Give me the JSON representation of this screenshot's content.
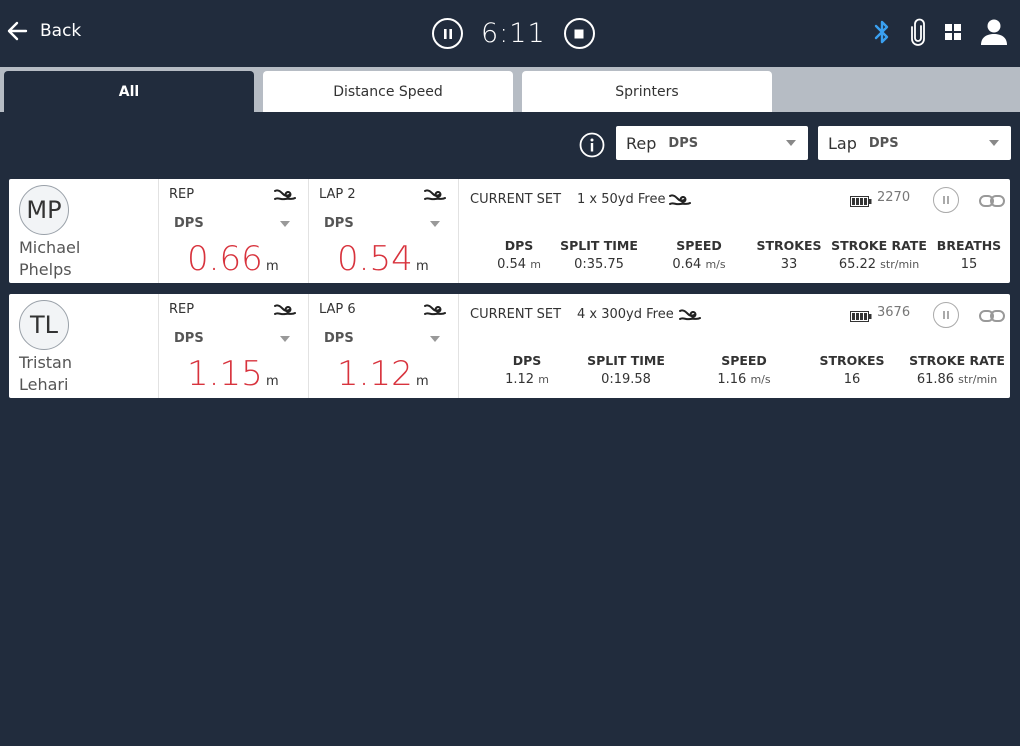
{
  "header": {
    "back_label": "Back",
    "timer": "6:11"
  },
  "tabs": [
    {
      "label": "All",
      "active": true
    },
    {
      "label": "Distance Speed",
      "active": false
    },
    {
      "label": "Sprinters",
      "active": false
    }
  ],
  "filters": {
    "rep": {
      "label": "Rep",
      "value": "DPS"
    },
    "lap": {
      "label": "Lap",
      "value": "DPS"
    }
  },
  "athletes": [
    {
      "initials": "MP",
      "first_name": "Michael",
      "last_name": "Phelps",
      "rep": {
        "label": "REP",
        "metric": "DPS",
        "value": "0.66",
        "unit": "m"
      },
      "lap": {
        "label": "LAP 2",
        "metric": "DPS",
        "value": "0.54",
        "unit": "m"
      },
      "current_set_label": "CURRENT SET",
      "set_desc": "1 x 50yd Free",
      "battery": "2270",
      "stats": [
        {
          "head": "DPS",
          "value": "0.54",
          "unit": "m"
        },
        {
          "head": "SPLIT TIME",
          "value": "0:35.75",
          "unit": ""
        },
        {
          "head": "SPEED",
          "value": "0.64",
          "unit": "m/s"
        },
        {
          "head": "STROKES",
          "value": "33",
          "unit": ""
        },
        {
          "head": "STROKE RATE",
          "value": "65.22",
          "unit": "str/min"
        },
        {
          "head": "BREATHS",
          "value": "15",
          "unit": ""
        }
      ]
    },
    {
      "initials": "TL",
      "first_name": "Tristan",
      "last_name": "Lehari",
      "rep": {
        "label": "REP",
        "metric": "DPS",
        "value": "1.15",
        "unit": "m"
      },
      "lap": {
        "label": "LAP 6",
        "metric": "DPS",
        "value": "1.12",
        "unit": "m"
      },
      "current_set_label": "CURRENT SET",
      "set_desc": "4 x 300yd Free",
      "battery": "3676",
      "stats": [
        {
          "head": "DPS",
          "value": "1.12",
          "unit": "m"
        },
        {
          "head": "SPLIT TIME",
          "value": "0:19.58",
          "unit": ""
        },
        {
          "head": "SPEED",
          "value": "1.16",
          "unit": "m/s"
        },
        {
          "head": "STROKES",
          "value": "16",
          "unit": ""
        },
        {
          "head": "STROKE RATE",
          "value": "61.86",
          "unit": "str/min"
        }
      ]
    }
  ],
  "colors": {
    "background": "#212c3d",
    "accent_red": "#d8333d",
    "bluetooth": "#3aa0f0"
  },
  "icons": [
    "back-arrow-icon",
    "pause-icon",
    "stop-icon",
    "bluetooth-icon",
    "paperclip-icon",
    "grid-icon",
    "user-icon",
    "info-icon",
    "swimmer-icon",
    "battery-icon",
    "link-icon"
  ]
}
